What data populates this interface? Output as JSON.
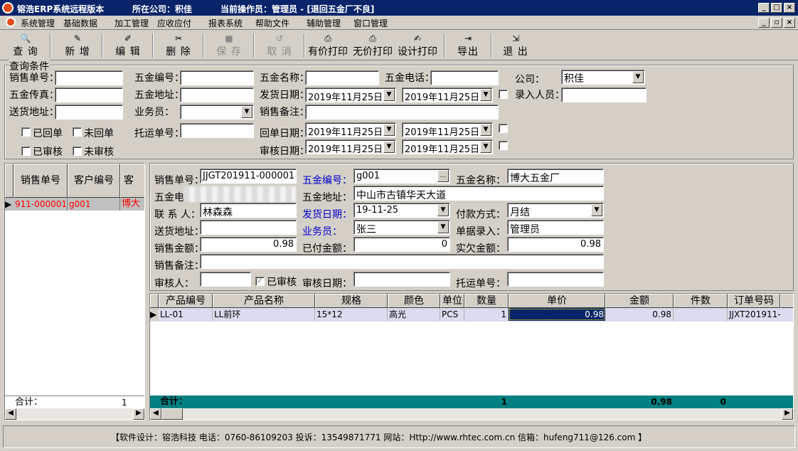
{
  "title": {
    "app": "镕浩ERP系统远程版本",
    "company": "所在公司：积佳",
    "operator": "当前操作员：管理员 - [退回五金厂不良]"
  },
  "menu": [
    "系统管理",
    "基础数据",
    "加工管理",
    "应收应付",
    "报表系统",
    "帮助文件",
    "辅助管理",
    "窗口管理"
  ],
  "toolbar": {
    "query": "查 询",
    "new": "新 增",
    "edit": "编 辑",
    "delete": "删 除",
    "save": "保 存",
    "cancel": "取 消",
    "print_price": "有价打印",
    "print_noprice": "无价打印",
    "design_print": "设计打印",
    "export": "导出",
    "exit": "退 出"
  },
  "query": {
    "group_title": "查询条件",
    "sale_no": "销售单号：",
    "hw_no": "五金编号：",
    "hw_name": "五金名称：",
    "hw_phone": "五金电话：",
    "company": "公司：",
    "company_value": "积佳",
    "hw_fax": "五金传真：",
    "hw_addr": "五金地址：",
    "ship_date": "发货日期：",
    "date1": "2019年11月25日",
    "date2": "2019年11月25日",
    "entry_person": "录入人员：",
    "deliver_addr": "送货地址：",
    "salesman": "业务员：",
    "sale_note": "销售备注：",
    "returned": "已回单",
    "not_returned": "未回单",
    "tracking": "托运单号：",
    "return_date": "回单日期：",
    "audited": "已审核",
    "not_audited": "未审核",
    "audit_date": "审核日期："
  },
  "left_grid": {
    "headers": [
      "销售单号",
      "客户编号",
      "客"
    ],
    "row": [
      "911-000001",
      "g001",
      "博大"
    ],
    "total_label": "合计：",
    "total_value": "1"
  },
  "detail": {
    "sale_no_label": "销售单号：",
    "sale_no": "JJGT201911-000001",
    "hw_no_label": "五金编号：",
    "hw_no": "g001",
    "hw_name_label": "五金名称：",
    "hw_name": "博大五金厂",
    "hw_phone_label": "五金电",
    "hw_addr_label": "五金地址：",
    "hw_addr": "中山市古镇华天大道",
    "contact_label": "联 系 人：",
    "contact": "林森森",
    "ship_date_label": "发货日期：",
    "ship_date": "19-11-25",
    "pay_label": "付款方式：",
    "pay": "月结",
    "deliver_label": "送货地址：",
    "salesman_label": "业务员：",
    "salesman": "张三",
    "entry_label": "单据录入：",
    "entry": "管理员",
    "sale_amt_label": "销售金额：",
    "sale_amt": "0.98",
    "paid_label": "已付金额：",
    "paid": "0",
    "owed_label": "实欠金额：",
    "owed": "0.98",
    "note_label": "销售备注：",
    "auditor_label": "审核人：",
    "audited_label": "已审核",
    "audit_date_label": "审核日期：",
    "tracking_label": "托运单号："
  },
  "items": {
    "headers": [
      "产品编号",
      "产品名称",
      "规格",
      "颜色",
      "单位",
      "数量",
      "单价",
      "金额",
      "件数",
      "订单号码"
    ],
    "rows": [
      [
        "LL-01",
        "LL前环",
        "15*12",
        "高光",
        "PCS",
        "1",
        "0.98",
        "0.98",
        "",
        "JJXT201911-"
      ]
    ],
    "total_label": "合计：",
    "total_qty": "1",
    "total_amt": "0.98",
    "total_pieces": "0"
  },
  "status": "【软件设计：镕浩科技 电话：0760-86109203 投诉：13549871771 网站：Http://www.rhtec.com.cn 信箱：hufeng711@126.com 】"
}
